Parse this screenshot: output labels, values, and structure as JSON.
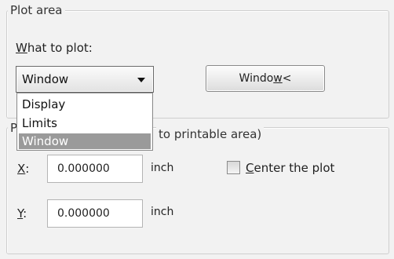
{
  "plot_area": {
    "group_title": "Plot area",
    "what_to_plot_label": "What to plot:",
    "selected_value": "Window",
    "options": [
      "Display",
      "Limits",
      "Window"
    ],
    "window_button_label": "Window<"
  },
  "plot_offset": {
    "group_title_visible_suffix": "to printable area)",
    "group_title_prefix": "P",
    "x_label": "X:",
    "x_value": "0.000000",
    "x_unit": "inch",
    "y_label": "Y:",
    "y_value": "0.000000",
    "y_unit": "inch",
    "center_the_plot_label": "Center the plot"
  }
}
